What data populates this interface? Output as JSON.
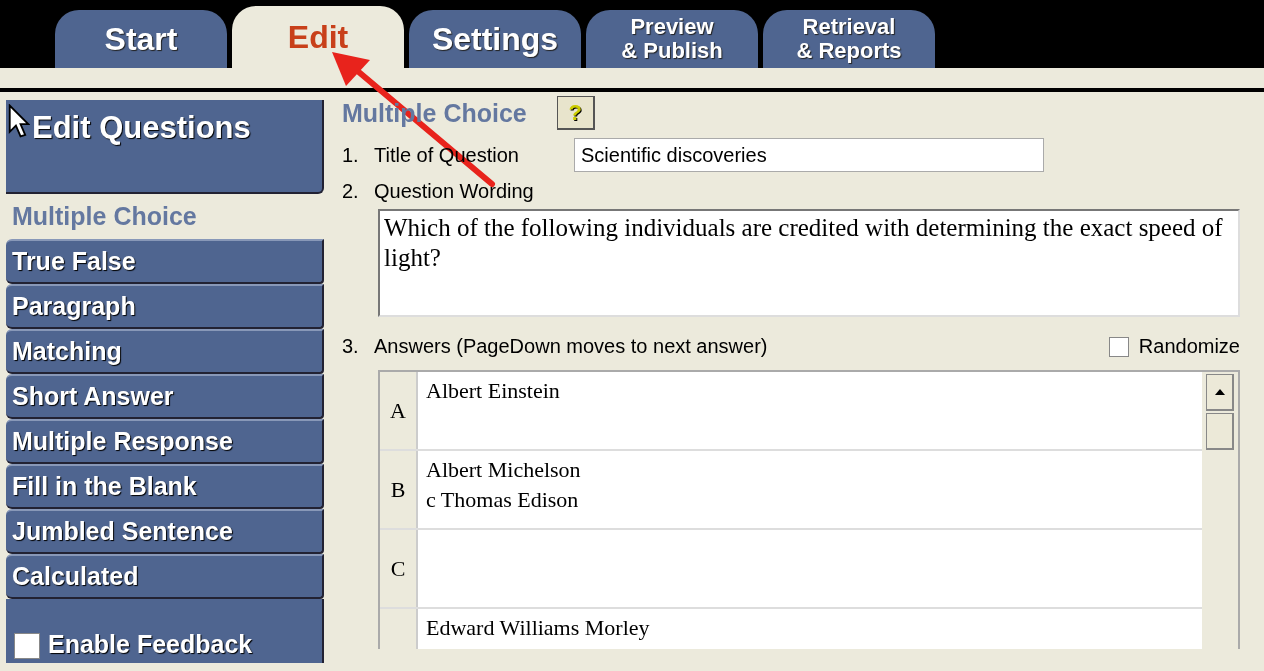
{
  "tabs": [
    {
      "lines": [
        "Start"
      ],
      "selected": false
    },
    {
      "lines": [
        "Edit"
      ],
      "selected": true
    },
    {
      "lines": [
        "Settings"
      ],
      "selected": false
    },
    {
      "lines": [
        "Preview",
        "& Publish"
      ],
      "selected": false
    },
    {
      "lines": [
        "Retrieval",
        "& Reports"
      ],
      "selected": false
    }
  ],
  "sidebar": {
    "title": "Edit Questions",
    "items": [
      {
        "label": "Multiple Choice",
        "selected": true
      },
      {
        "label": "True False",
        "selected": false
      },
      {
        "label": "Paragraph",
        "selected": false
      },
      {
        "label": "Matching",
        "selected": false
      },
      {
        "label": "Short Answer",
        "selected": false
      },
      {
        "label": "Multiple Response",
        "selected": false
      },
      {
        "label": "Fill in the Blank",
        "selected": false
      },
      {
        "label": "Jumbled Sentence",
        "selected": false
      },
      {
        "label": "Calculated",
        "selected": false
      }
    ],
    "feedback": {
      "label": "Enable Feedback",
      "checked": false
    }
  },
  "editor": {
    "heading": "Multiple Choice",
    "help": "?",
    "title_field": {
      "number": "1.",
      "label": "Title of Question",
      "value": "Scientific discoveries"
    },
    "wording": {
      "number": "2.",
      "label": "Question Wording",
      "value": "Which of the following individuals are credited with determining the exact speed of light?"
    },
    "answers": {
      "number": "3.",
      "label": "Answers  (PageDown moves to next answer)",
      "randomize": {
        "label": "Randomize",
        "checked": false
      },
      "rows": [
        {
          "letter": "A",
          "lines": [
            "Albert Einstein"
          ]
        },
        {
          "letter": "B",
          "lines": [
            "Albert Michelson",
            "c Thomas Edison"
          ]
        },
        {
          "letter": "C",
          "lines": []
        },
        {
          "letter": "",
          "lines": [
            "Edward Williams Morley"
          ]
        }
      ]
    }
  }
}
